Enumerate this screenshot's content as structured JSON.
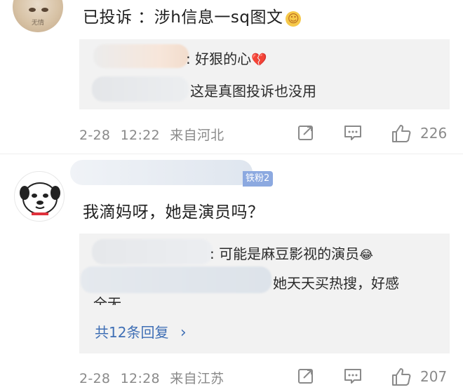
{
  "comment1": {
    "avatar_caption": "无情",
    "text": "已投诉 ：涉h信息一sq图文",
    "emoji": "☺",
    "replies": [
      {
        "name_suffix": ":",
        "text": "好狠的心",
        "emoji": "💔"
      },
      {
        "text": "这是真图投诉也没用"
      }
    ],
    "meta": {
      "date": "2-28",
      "time": "12:22",
      "location": "来自河北"
    },
    "likes": "226"
  },
  "comment2": {
    "badge": "铁粉2",
    "text": "我滴妈呀，她是演员吗？",
    "replies": [
      {
        "name_suffix": ":",
        "text": "可能是麻豆影视的演员",
        "emoji": "😂"
      },
      {
        "text": "她天天买热搜，好感",
        "text_cont": "全无"
      }
    ],
    "more_replies": "共12条回复",
    "more_chevron": "›",
    "meta": {
      "date": "2-28",
      "time": "12:28",
      "location": "来自江苏"
    },
    "likes": "207"
  },
  "icons": [
    "share-icon",
    "comment-icon",
    "thumbs-up-icon",
    "chevron-right-icon",
    "heart-broken-emoji",
    "smile-emoji",
    "laugh-emoji"
  ],
  "colors": {
    "link": "#3f6fb5",
    "meta_gray": "#8a8a8a",
    "reply_bg": "#f2f2f2",
    "badge_bg": "#8ca9e0"
  }
}
